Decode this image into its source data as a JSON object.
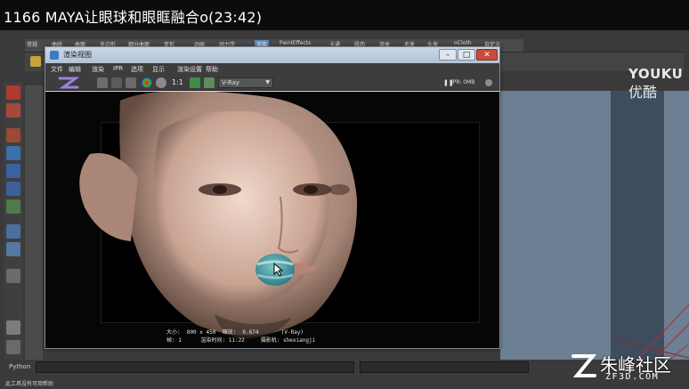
{
  "video": {
    "title": "1166 MAYA让眼球和眼眶融合o(23:42)"
  },
  "maya": {
    "menu_items": [
      "常规",
      "曲线",
      "曲面",
      "多边形",
      "细分曲面",
      "变形",
      "动画",
      "动力学",
      "渲染",
      "PaintEffects",
      "卡通",
      "肌肉",
      "流体",
      "毛发",
      "头发",
      "nCloth",
      "自定义"
    ],
    "active_menu_index": 8,
    "python_label": "Python",
    "status_text": "此工具没有可用帮助"
  },
  "branding": {
    "youku_en": "YOUKU",
    "youku_cn": "优酷",
    "watermark_cn": "朱峰社区",
    "watermark_url": "ZF3D.COM"
  },
  "render_window": {
    "title": "渲染视图",
    "menu": [
      "文件",
      "编辑",
      "渲染",
      "IPR",
      "选项",
      "显示",
      "渲染设置",
      "帮助"
    ],
    "ratio_label": "1:1",
    "renderer": "V-Ray",
    "ipr_status": "IPR: 0MB",
    "info_line1": "大小:  800 x 450  缩放:  0.674       (V-Ray)",
    "info_line2": "帧: 1      渲染时间: 11:22     摄影机: shexiangji"
  },
  "colors": {
    "accent": "#5c87b5",
    "close_button": "#c84c3c",
    "viewport": "#6d7f92",
    "skin": "#d8b49c"
  },
  "icons": [
    "z-logo-icon",
    "cursor-arrow-icon",
    "pause-icon",
    "dropdown-arrow-icon"
  ]
}
